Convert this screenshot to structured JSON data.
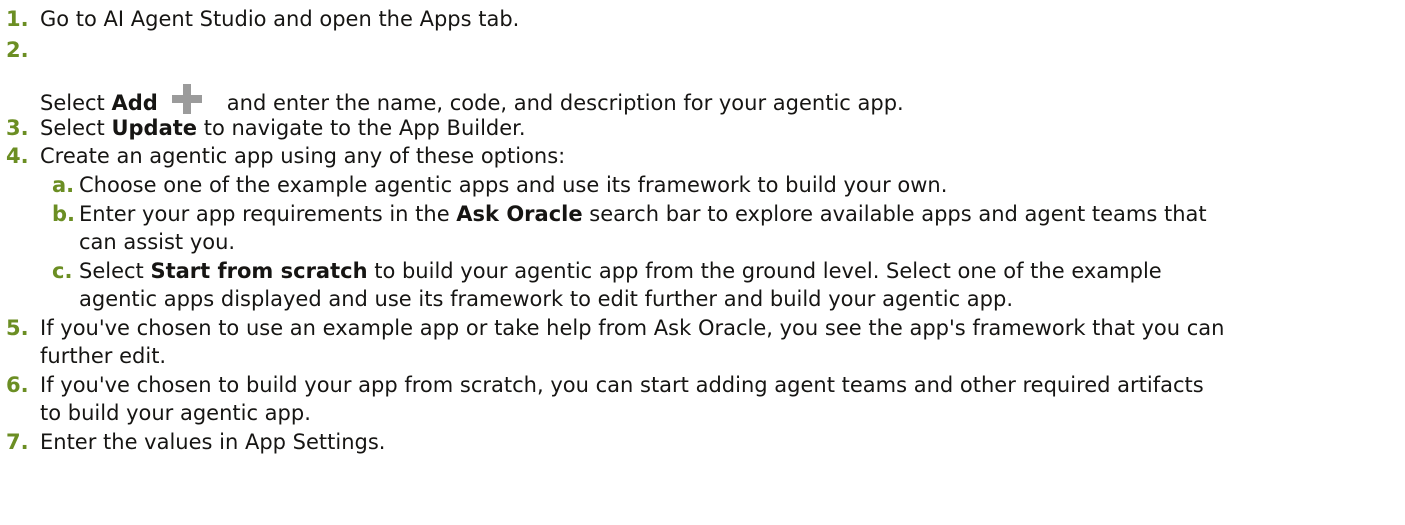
{
  "steps": [
    {
      "number": "1.",
      "text": "Go to AI Agent Studio and open the Apps tab."
    },
    {
      "number": "2.",
      "prefix": "Select ",
      "bold": "Add",
      "suffix": "and enter the name, code, and description for your agentic app.",
      "icon": "plus-icon"
    },
    {
      "number": "3.",
      "prefix": "Select ",
      "bold": "Update",
      "suffix": " to navigate to the App Builder."
    },
    {
      "number": "4.",
      "text": "Create an agentic app using any of these options:",
      "substeps": [
        {
          "letter": "a.",
          "text": "Choose one of the example agentic apps and use its framework to build your own."
        },
        {
          "letter": "b.",
          "prefix": "Enter your app requirements in the ",
          "bold": "Ask Oracle",
          "line1_rest": " search bar to explore available apps and agent teams that",
          "line2": "can assist you."
        },
        {
          "letter": "c.",
          "prefix": "Select ",
          "bold": "Start from scratch",
          "line1_rest": " to build your agentic app from the ground level. Select one of the example",
          "line2": "agentic apps displayed and use its framework to edit further and build your agentic app."
        }
      ]
    },
    {
      "number": "5.",
      "line1": "If you've chosen to use an example app or take help from Ask Oracle, you see the app's framework that you can",
      "line2": "further edit."
    },
    {
      "number": "6.",
      "line1": "If you've chosen to build your app from scratch, you can start adding agent teams and other required artifacts",
      "line2": "to build your agentic app."
    },
    {
      "number": "7.",
      "text": "Enter the values in App Settings."
    }
  ],
  "colors": {
    "step_number": "#6b8e23",
    "text": "#161513",
    "icon": "#9b9b9b"
  }
}
